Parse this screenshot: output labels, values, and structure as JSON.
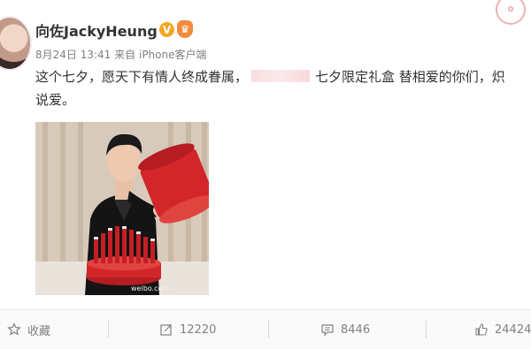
{
  "post": {
    "author": "向佐JackyHeung",
    "verified_badge": "V",
    "date": "8月24日 13:41",
    "source_prefix": "来自",
    "source": "iPhone客户端",
    "text_line1_part1": "这个七夕，愿天下有情人终成眷属，",
    "text_line1_part2": "七夕限定礼盒 替相爱的你们，",
    "text_line1_tail": "炽",
    "text_line2": "说爱。",
    "image_watermark": "weibo.com"
  },
  "actions": {
    "favorite_label": "收藏",
    "repost_count": "12220",
    "comment_count": "8446",
    "like_count": "24424"
  },
  "colors": {
    "muted": "#808080",
    "badge": "#f6a623",
    "gift_red": "#d2262b"
  }
}
